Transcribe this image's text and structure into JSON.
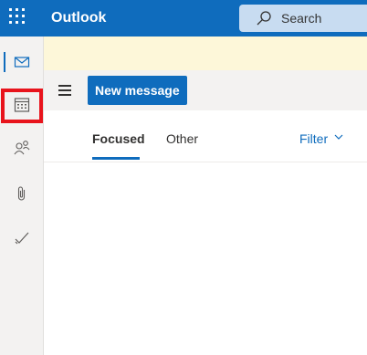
{
  "header": {
    "app_title": "Outlook",
    "search_placeholder": "Search",
    "waffle_icon": "app-launcher-icon",
    "search_icon": "search-icon",
    "background": "#0f6cbd"
  },
  "rail": {
    "items": [
      {
        "icon": "mail-icon",
        "active": true
      },
      {
        "icon": "calendar-icon",
        "active": false,
        "highlighted": true
      },
      {
        "icon": "people-icon",
        "active": false
      },
      {
        "icon": "attachment-icon",
        "active": false
      },
      {
        "icon": "todo-icon",
        "active": false
      }
    ],
    "highlight_color": "#e8141c"
  },
  "toolbar": {
    "menu_icon": "hamburger-icon",
    "new_message_label": "New message"
  },
  "mail_list": {
    "tabs": [
      {
        "label": "Focused",
        "selected": true
      },
      {
        "label": "Other",
        "selected": false
      }
    ],
    "filter_label": "Filter",
    "filter_icon": "chevron-down-icon"
  },
  "colors": {
    "accent": "#0f6cbd",
    "banner": "#fdf7d9"
  }
}
